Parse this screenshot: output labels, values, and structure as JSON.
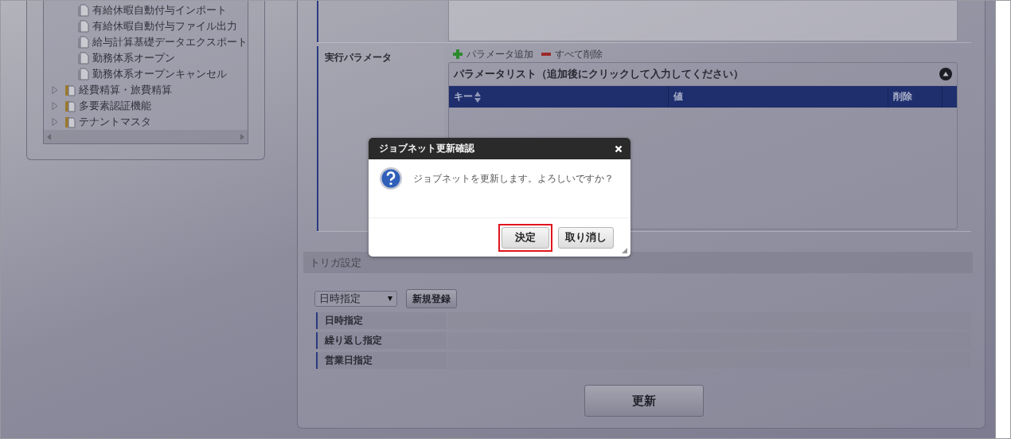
{
  "tree": {
    "items": [
      {
        "label": "有給休暇自動付与インポート",
        "kind": "leaf"
      },
      {
        "label": "有給休暇自動付与ファイル出力",
        "kind": "leaf"
      },
      {
        "label": "給与計算基礎データエクスポート",
        "kind": "leaf"
      },
      {
        "label": "勤務体系オープン",
        "kind": "leaf"
      },
      {
        "label": "勤務体系オープンキャンセル",
        "kind": "leaf"
      },
      {
        "label": "経費精算・旅費精算",
        "kind": "folder",
        "expanded": false
      },
      {
        "label": "多要素認証機能",
        "kind": "folder",
        "expanded": false
      },
      {
        "label": "テナントマスタ",
        "kind": "folder",
        "expanded": false
      }
    ]
  },
  "form": {
    "rows": [
      {
        "label": "",
        "kind": "textarea"
      },
      {
        "label": "実行パラメータ",
        "kind": "parameters"
      }
    ]
  },
  "parameters": {
    "add_label": "パラメータ追加",
    "clear_label": "すべて削除",
    "list_title": "パラメータリスト（追加後にクリックして入力してください）",
    "columns": [
      "キー",
      "値",
      "削除"
    ]
  },
  "trigger": {
    "title": "トリガ設定",
    "select_value": "日時指定",
    "new_button": "新規登録",
    "rows": [
      "日時指定",
      "繰り返し指定",
      "営業日指定"
    ]
  },
  "update_button": "更新",
  "dialog": {
    "title": "ジョブネット更新確認",
    "message": "ジョブネットを更新します。よろしいですか？",
    "buttons": [
      {
        "label": "決定",
        "highlighted": true
      },
      {
        "label": "取り消し",
        "highlighted": false
      }
    ]
  }
}
